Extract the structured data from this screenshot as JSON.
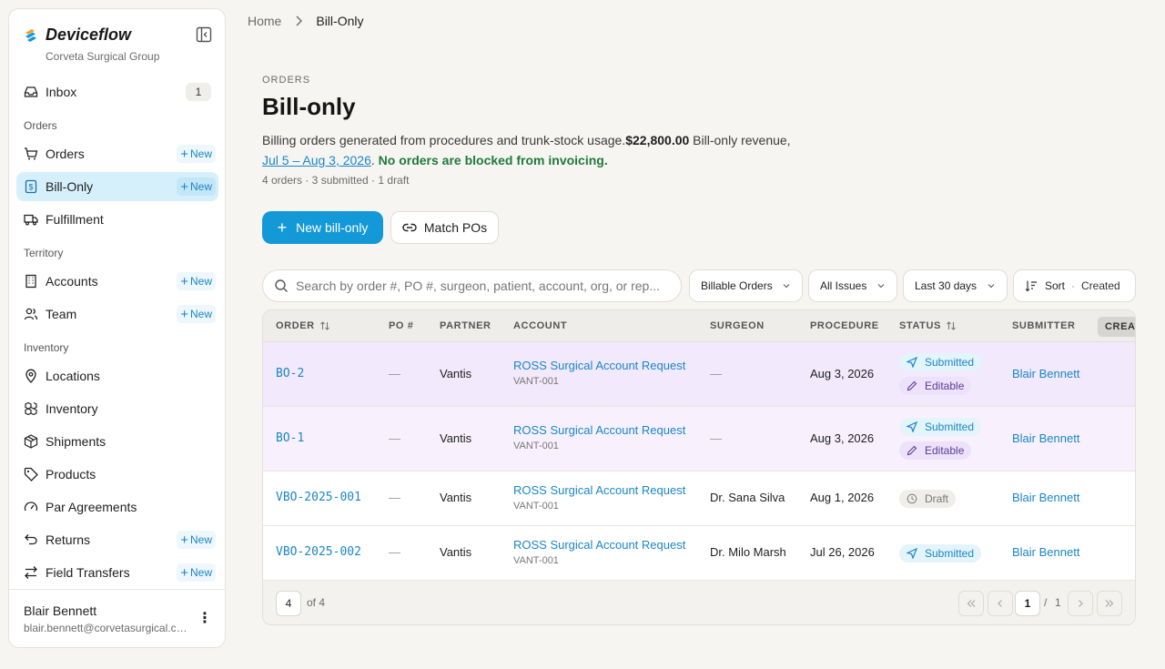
{
  "brand": {
    "name": "Deviceflow",
    "org": "Corveta Surgical Group"
  },
  "sidebar": {
    "inbox": {
      "label": "Inbox",
      "badge": "1"
    },
    "new_label": "New",
    "sections": {
      "orders": "Orders",
      "territory": "Territory",
      "inventory": "Inventory"
    },
    "items": {
      "orders": "Orders",
      "bill_only": "Bill-Only",
      "fulfillment": "Fulfillment",
      "accounts": "Accounts",
      "team": "Team",
      "locations": "Locations",
      "inventory": "Inventory",
      "shipments": "Shipments",
      "products": "Products",
      "par_agreements": "Par Agreements",
      "returns": "Returns",
      "field_transfers": "Field Transfers"
    },
    "user": {
      "name": "Blair Bennett",
      "email": "blair.bennett@corvetasurgical.com"
    }
  },
  "breadcrumb": {
    "home": "Home",
    "current": "Bill-Only"
  },
  "header": {
    "eyebrow": "ORDERS",
    "title": "Bill-only",
    "desc_prefix": "Billing orders generated from procedures and trunk-stock usage.",
    "amount": "$22,800.00",
    "desc_mid": " Bill-only revenue,",
    "date_range": "Jul 5 – Aug 3, 2026",
    "period": ".",
    "status_msg": "No orders are blocked from invoicing.",
    "meta": "4 orders · 3 submitted · 1 draft"
  },
  "actions": {
    "new_bill_only": "New bill-only",
    "match_pos": "Match POs"
  },
  "filters": {
    "search_placeholder": "Search by order #, PO #, surgeon, patient, account, org, or rep...",
    "billable": "Billable Orders",
    "issues": "All Issues",
    "period": "Last 30 days",
    "sort_label": "Sort",
    "sort_value": "Created"
  },
  "table": {
    "headers": {
      "order": "ORDER",
      "po": "PO #",
      "partner": "PARTNER",
      "account": "ACCOUNT",
      "surgeon": "SURGEON",
      "procedure": "PROCEDURE",
      "status": "STATUS",
      "submitter": "SUBMITTER",
      "created": "CREAT"
    },
    "rows": [
      {
        "order": "BO-2",
        "po": "—",
        "partner": "Vantis",
        "account": "ROSS Surgical Account Request",
        "account_code": "VANT-001",
        "surgeon": "—",
        "procedure": "Aug 3, 2026",
        "status": "Submitted",
        "status2": "Editable",
        "submitter": "Blair Bennett"
      },
      {
        "order": "BO-1",
        "po": "—",
        "partner": "Vantis",
        "account": "ROSS Surgical Account Request",
        "account_code": "VANT-001",
        "surgeon": "—",
        "procedure": "Aug 3, 2026",
        "status": "Submitted",
        "status2": "Editable",
        "submitter": "Blair Bennett"
      },
      {
        "order": "VBO-2025-001",
        "po": "—",
        "partner": "Vantis",
        "account": "ROSS Surgical Account Request",
        "account_code": "VANT-001",
        "surgeon": "Dr. Sana Silva",
        "procedure": "Aug 1, 2026",
        "status": "Draft",
        "submitter": "Blair Bennett"
      },
      {
        "order": "VBO-2025-002",
        "po": "—",
        "partner": "Vantis",
        "account": "ROSS Surgical Account Request",
        "account_code": "VANT-001",
        "surgeon": "Dr. Milo Marsh",
        "procedure": "Jul 26, 2026",
        "status": "Submitted",
        "submitter": "Blair Bennett"
      }
    ],
    "footer": {
      "page_size": "4",
      "of_total": "of 4",
      "page": "1",
      "sep": "/",
      "pages": "1"
    }
  },
  "colors": {
    "accent": "#1398d8",
    "active_nav": "#d6f0fb",
    "success": "#1f7a3a",
    "editable": "#5b3c9a"
  }
}
